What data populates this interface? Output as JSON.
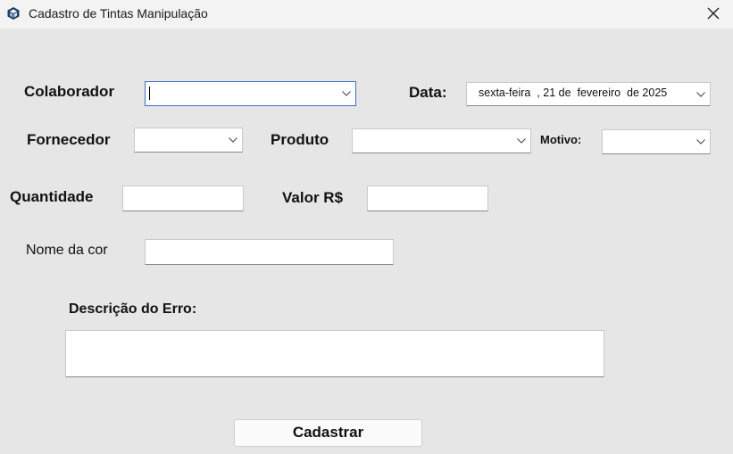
{
  "window": {
    "title": "Cadastro de Tintas Manipulação"
  },
  "labels": {
    "colaborador": "Colaborador",
    "data": "Data:",
    "fornecedor": "Fornecedor",
    "produto": "Produto",
    "motivo": "Motivo:",
    "quantidade": "Quantidade",
    "valor": "Valor R$",
    "nome_cor": "Nome da cor",
    "descricao": "Descrição do Erro:"
  },
  "fields": {
    "colaborador": "",
    "data": "sexta-feira  , 21 de  fevereiro  de 2025",
    "fornecedor": "",
    "produto": "",
    "motivo": "",
    "quantidade": "",
    "valor": "",
    "nome_cor": "",
    "descricao": ""
  },
  "buttons": {
    "cadastrar": "Cadastrar"
  }
}
